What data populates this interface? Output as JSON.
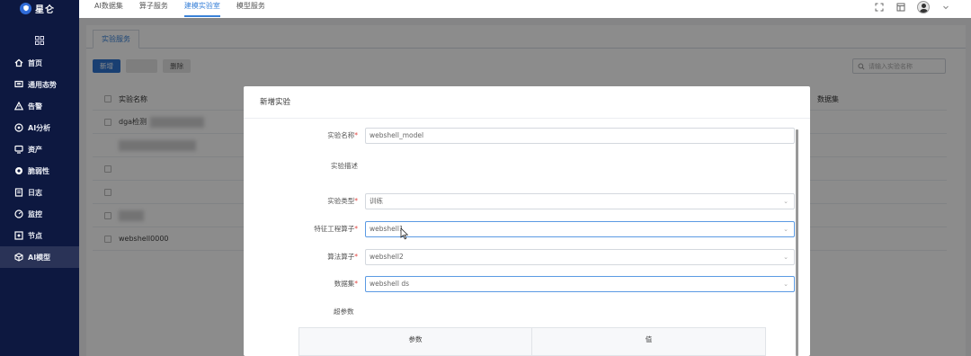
{
  "brand": {
    "name": "星仑"
  },
  "top_nav": [
    "AI数据集",
    "算子服务",
    "建模实验室",
    "模型服务"
  ],
  "top_nav_active": 2,
  "sidebar": {
    "items": [
      {
        "label": "首页",
        "icon": "home-icon"
      },
      {
        "label": "通用态势",
        "icon": "monitor-icon"
      },
      {
        "label": "告警",
        "icon": "warning-icon"
      },
      {
        "label": "AI分析",
        "icon": "ai-icon"
      },
      {
        "label": "资产",
        "icon": "asset-icon"
      },
      {
        "label": "脆弱性",
        "icon": "vulnerability-icon"
      },
      {
        "label": "日志",
        "icon": "log-icon"
      },
      {
        "label": "监控",
        "icon": "monitor-gauge-icon"
      },
      {
        "label": "节点",
        "icon": "node-icon"
      },
      {
        "label": "AI模型",
        "icon": "cube-icon"
      }
    ],
    "active_index": 9
  },
  "page": {
    "subtab": "实验服务",
    "toolbar": {
      "new": "新增",
      "delete": "删除"
    },
    "search_placeholder": "请输入实验名称",
    "table": {
      "col_name": "实验名称",
      "col_dataset": "数据集",
      "rows": [
        {
          "name": "dga检测"
        },
        {
          "name": ""
        },
        {
          "name": ""
        },
        {
          "name": ""
        },
        {
          "name": ""
        },
        {
          "name": "webshell0000"
        }
      ]
    }
  },
  "modal": {
    "title": "新增实验",
    "fields": {
      "name_label": "实验名称",
      "name_value": "webshell_model",
      "desc_label": "实验描述",
      "desc_value": "",
      "type_label": "实验类型",
      "type_value": "训练",
      "feature_label": "特征工程算子",
      "feature_value": "webshell1",
      "algo_label": "算法算子",
      "algo_value": "webshell2",
      "dataset_label": "数据集",
      "dataset_value": "webshell ds"
    },
    "params_label": "超参数",
    "params_table": {
      "col_param": "参数",
      "col_value": "值"
    }
  },
  "colors": {
    "sidebar_bg": "#0d1840",
    "accent": "#2f74d0",
    "required": "#e0443f"
  }
}
